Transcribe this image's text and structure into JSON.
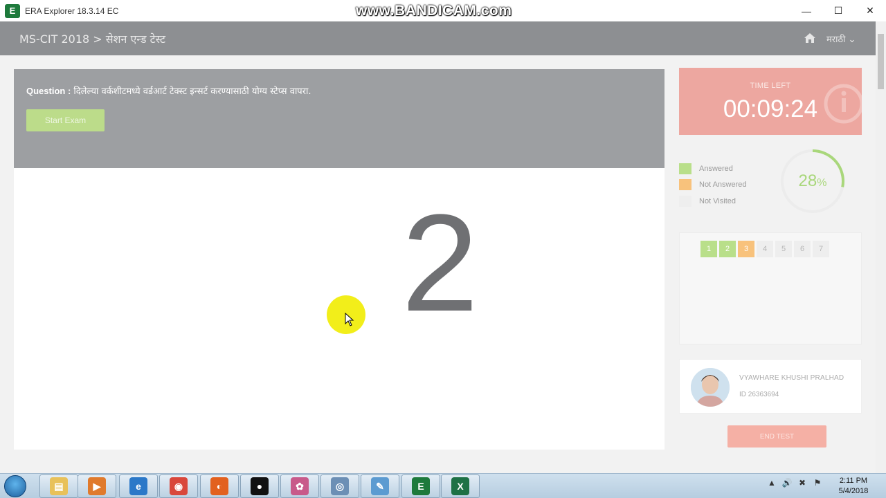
{
  "window": {
    "title": "ERA Explorer 18.3.14 EC",
    "logo_text": "E",
    "watermark": "www.BANDICAM.com",
    "minimize": "—",
    "maximize": "☐",
    "close": "✕"
  },
  "header": {
    "breadcrumb": "MS-CIT 2018 > सेशन एन्ड टेस्ट",
    "language": "मराठी ⌄",
    "home_icon": "home-icon"
  },
  "question": {
    "label": "Question :",
    "text": " दिलेल्या वर्कशीटमध्ये वर्डआर्ट टेक्स्ट इन्सर्ट करण्यासाठी योग्य स्टेप्स वापरा.",
    "start_button": "Start Exam",
    "countdown": "2"
  },
  "timer": {
    "label": "TIME LEFT",
    "value": "00:09:24"
  },
  "legend": [
    {
      "label": "Answered",
      "color": "#b9df8a"
    },
    {
      "label": "Not Answered",
      "color": "#f8c27c"
    },
    {
      "label": "Not Visited",
      "color": "#eeeeee"
    }
  ],
  "progress": {
    "value": "28",
    "unit": "%",
    "fraction": 0.28,
    "color": "#a9d77b"
  },
  "palette": [
    {
      "num": "1",
      "state": "answered"
    },
    {
      "num": "2",
      "state": "answered"
    },
    {
      "num": "3",
      "state": "notanswered"
    },
    {
      "num": "4",
      "state": "notvisited"
    },
    {
      "num": "5",
      "state": "notvisited"
    },
    {
      "num": "6",
      "state": "notvisited"
    },
    {
      "num": "7",
      "state": "notvisited"
    }
  ],
  "student": {
    "name": "VYAWHARE KHUSHI PRALHAD",
    "id": "ID 26363694"
  },
  "end_button": "END TEST",
  "taskbar": {
    "apps": [
      "file-explorer-icon",
      "media-player-icon",
      "internet-explorer-icon",
      "chrome-icon",
      "firefox-icon",
      "bandicam-icon",
      "photo-app-icon",
      "disc-icon",
      "paint-icon",
      "era-explorer-icon",
      "excel-icon"
    ],
    "time": "2:11 PM",
    "date": "5/4/2018"
  }
}
